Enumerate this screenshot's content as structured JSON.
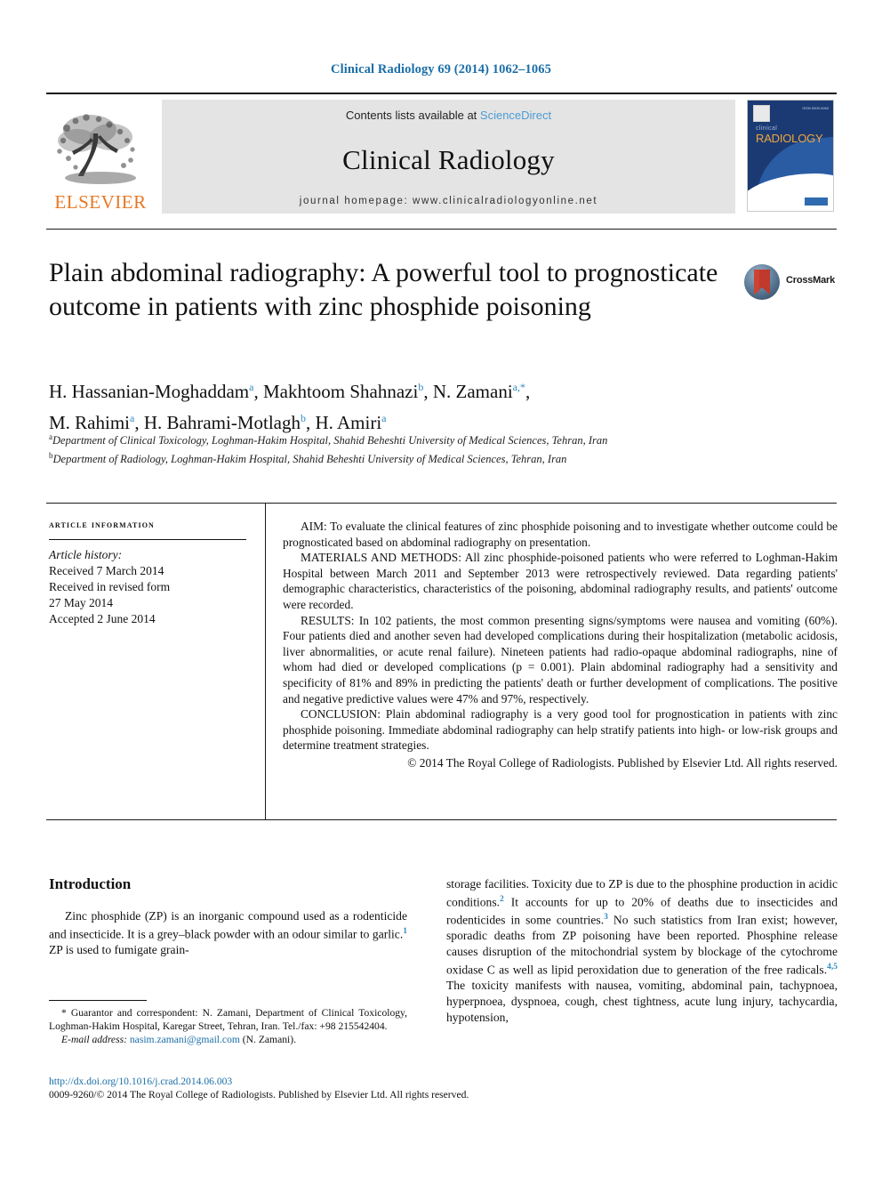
{
  "running_head": "Clinical Radiology 69 (2014) 1062–1065",
  "masthead": {
    "publisher_name": "ELSEVIER",
    "publisher_color": "#E87722",
    "contents_prefix": "Contents lists available at ",
    "contents_link": "ScienceDirect",
    "contents_link_color": "#4b9cd3",
    "journal_name": "Clinical Radiology",
    "homepage": "journal homepage: www.clinicalradiologyonline.net",
    "cover": {
      "title_small": "clinical",
      "title_large": "RADIOLOGY",
      "issn_corner": "ISSN 0009-9260",
      "background_color": "#1b3a73"
    }
  },
  "article": {
    "title": "Plain abdominal radiography: A powerful tool to prognosticate outcome in patients with zinc phosphide poisoning",
    "crossmark_label": "CrossMark",
    "authors_line_1_a": "H. Hassanian-Moghaddam",
    "authors_line_1_b": "Makhtoom Shahnazi",
    "authors_line_1_c": "N. Zamani",
    "authors_line_2_a": "M. Rahimi",
    "authors_line_2_b": "H. Bahrami-Motlagh",
    "authors_line_2_c": "H. Amiri",
    "affiliation_a": "Department of Clinical Toxicology, Loghman-Hakim Hospital, Shahid Beheshti University of Medical Sciences, Tehran, Iran",
    "affiliation_b": "Department of Radiology, Loghman-Hakim Hospital, Shahid Beheshti University of Medical Sciences, Tehran, Iran"
  },
  "article_info": {
    "heading": "Article Information",
    "history_title": "Article history:",
    "received": "Received 7 March 2014",
    "revised_label": "Received in revised form",
    "revised_date": "27 May 2014",
    "accepted": "Accepted 2 June 2014"
  },
  "abstract": {
    "aim": "AIM: To evaluate the clinical features of zinc phosphide poisoning and to investigate whether outcome could be prognosticated based on abdominal radiography on presentation.",
    "materials": "MATERIALS AND METHODS: All zinc phosphide-poisoned patients who were referred to Loghman-Hakim Hospital between March 2011 and September 2013 were retrospectively reviewed. Data regarding patients' demographic characteristics, characteristics of the poisoning, abdominal radiography results, and patients' outcome were recorded.",
    "results": "RESULTS: In 102 patients, the most common presenting signs/symptoms were nausea and vomiting (60%). Four patients died and another seven had developed complications during their hospitalization (metabolic acidosis, liver abnormalities, or acute renal failure). Nineteen patients had radio-opaque abdominal radiographs, nine of whom had died or developed complications (p = 0.001). Plain abdominal radiography had a sensitivity and specificity of 81% and 89% in predicting the patients' death or further development of complications. The positive and negative predictive values were 47% and 97%, respectively.",
    "conclusion": "CONCLUSION: Plain abdominal radiography is a very good tool for prognostication in patients with zinc phosphide poisoning. Immediate abdominal radiography can help stratify patients into high- or low-risk groups and determine treatment strategies.",
    "copyright": "© 2014 The Royal College of Radiologists. Published by Elsevier Ltd. All rights reserved."
  },
  "body": {
    "intro_heading": "Introduction",
    "left_para_1a": "Zinc phosphide (ZP) is an inorganic compound used as a rodenticide and insecticide. It is a grey–black powder with an odour similar to garlic.",
    "left_ref_1": "1",
    "left_para_1b": " ZP is used to fumigate grain-",
    "right_para_1a": "storage facilities. Toxicity due to ZP is due to the phosphine production in acidic conditions.",
    "right_ref_2": "2",
    "right_para_1b": " It accounts for up to 20% of deaths due to insecticides and rodenticides in some countries.",
    "right_ref_3": "3",
    "right_para_1c": " No such statistics from Iran exist; however, sporadic deaths from ZP poisoning have been reported. Phosphine release causes disruption of the mitochondrial system by blockage of the cytochrome oxidase C as well as lipid peroxidation due to generation of the free radicals.",
    "right_ref_45": "4,5",
    "right_para_1d": " The toxicity manifests with nausea, vomiting, abdominal pain, tachypnoea, hyperpnoea, dyspnoea, cough, chest tightness, acute lung injury, tachycardia, hypotension,"
  },
  "footnotes": {
    "correspondence": "* Guarantor and correspondent: N. Zamani, Department of Clinical Toxicology, Loghman-Hakim Hospital, Karegar Street, Tehran, Iran. Tel./fax: +98 215542404.",
    "email_label": "E-mail address:",
    "email": "nasim.zamani@gmail.com",
    "email_suffix": "(N. Zamani)."
  },
  "bottom": {
    "doi": "http://dx.doi.org/10.1016/j.crad.2014.06.003",
    "issn_line": "0009-9260/© 2014 The Royal College of Radiologists. Published by Elsevier Ltd. All rights reserved."
  }
}
